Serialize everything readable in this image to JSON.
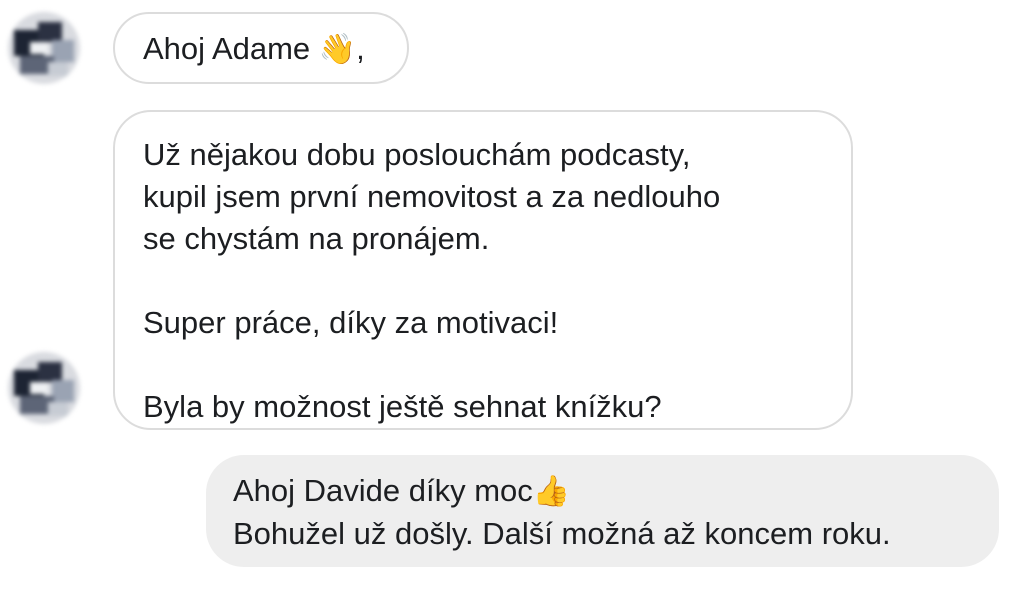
{
  "conversation": {
    "messages": [
      {
        "sender": "incoming",
        "lines": [
          "Ahoj Adame",
          ","
        ],
        "emoji": "waving-hand"
      },
      {
        "sender": "incoming",
        "paragraph1": [
          "Už nějakou dobu poslouchám podcasty,",
          "kupil jsem první nemovitost a za nedlouho",
          "se chystám na pronájem."
        ],
        "paragraph2": "Super práce, díky za motivaci!",
        "paragraph3": "Byla by možnost ještě sehnat knížku?"
      },
      {
        "sender": "outgoing",
        "line1": "Ahoj Davide díky moc",
        "emoji": "thumbs-up",
        "line2": "Bohužel už došly. Další možná až koncem roku."
      }
    ]
  },
  "glyphs": {
    "wave": "👋",
    "thumb": "👍"
  },
  "colors": {
    "incoming_bubble_border": "#dcdcdc",
    "outgoing_bubble_bg": "#eeeeee",
    "text": "#1c1e21"
  }
}
